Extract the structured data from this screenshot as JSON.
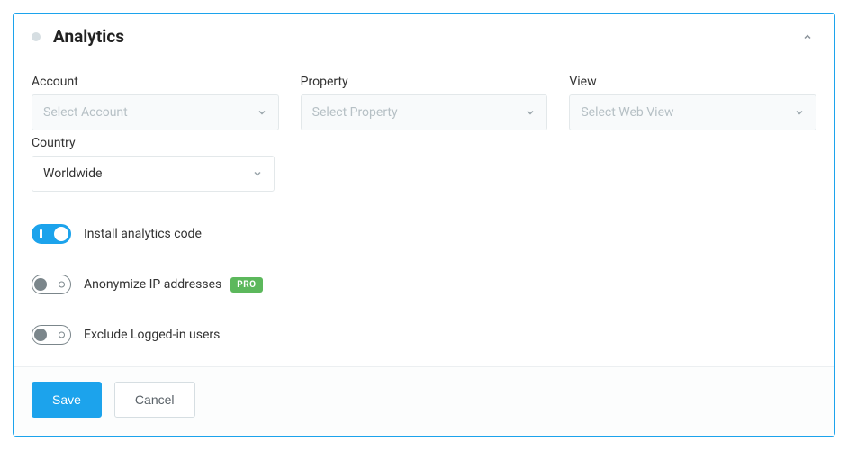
{
  "header": {
    "title": "Analytics"
  },
  "fields": {
    "account": {
      "label": "Account",
      "placeholder": "Select Account",
      "value": ""
    },
    "property": {
      "label": "Property",
      "placeholder": "Select Property",
      "value": ""
    },
    "view": {
      "label": "View",
      "placeholder": "Select Web View",
      "value": ""
    },
    "country": {
      "label": "Country",
      "value": "Worldwide"
    }
  },
  "toggles": {
    "install_code": {
      "label": "Install analytics code",
      "on": true
    },
    "anonymize_ip": {
      "label": "Anonymize IP addresses",
      "on": false,
      "badge": "PRO"
    },
    "exclude_loggedin": {
      "label": "Exclude Logged-in users",
      "on": false
    }
  },
  "footer": {
    "save_label": "Save",
    "cancel_label": "Cancel"
  }
}
